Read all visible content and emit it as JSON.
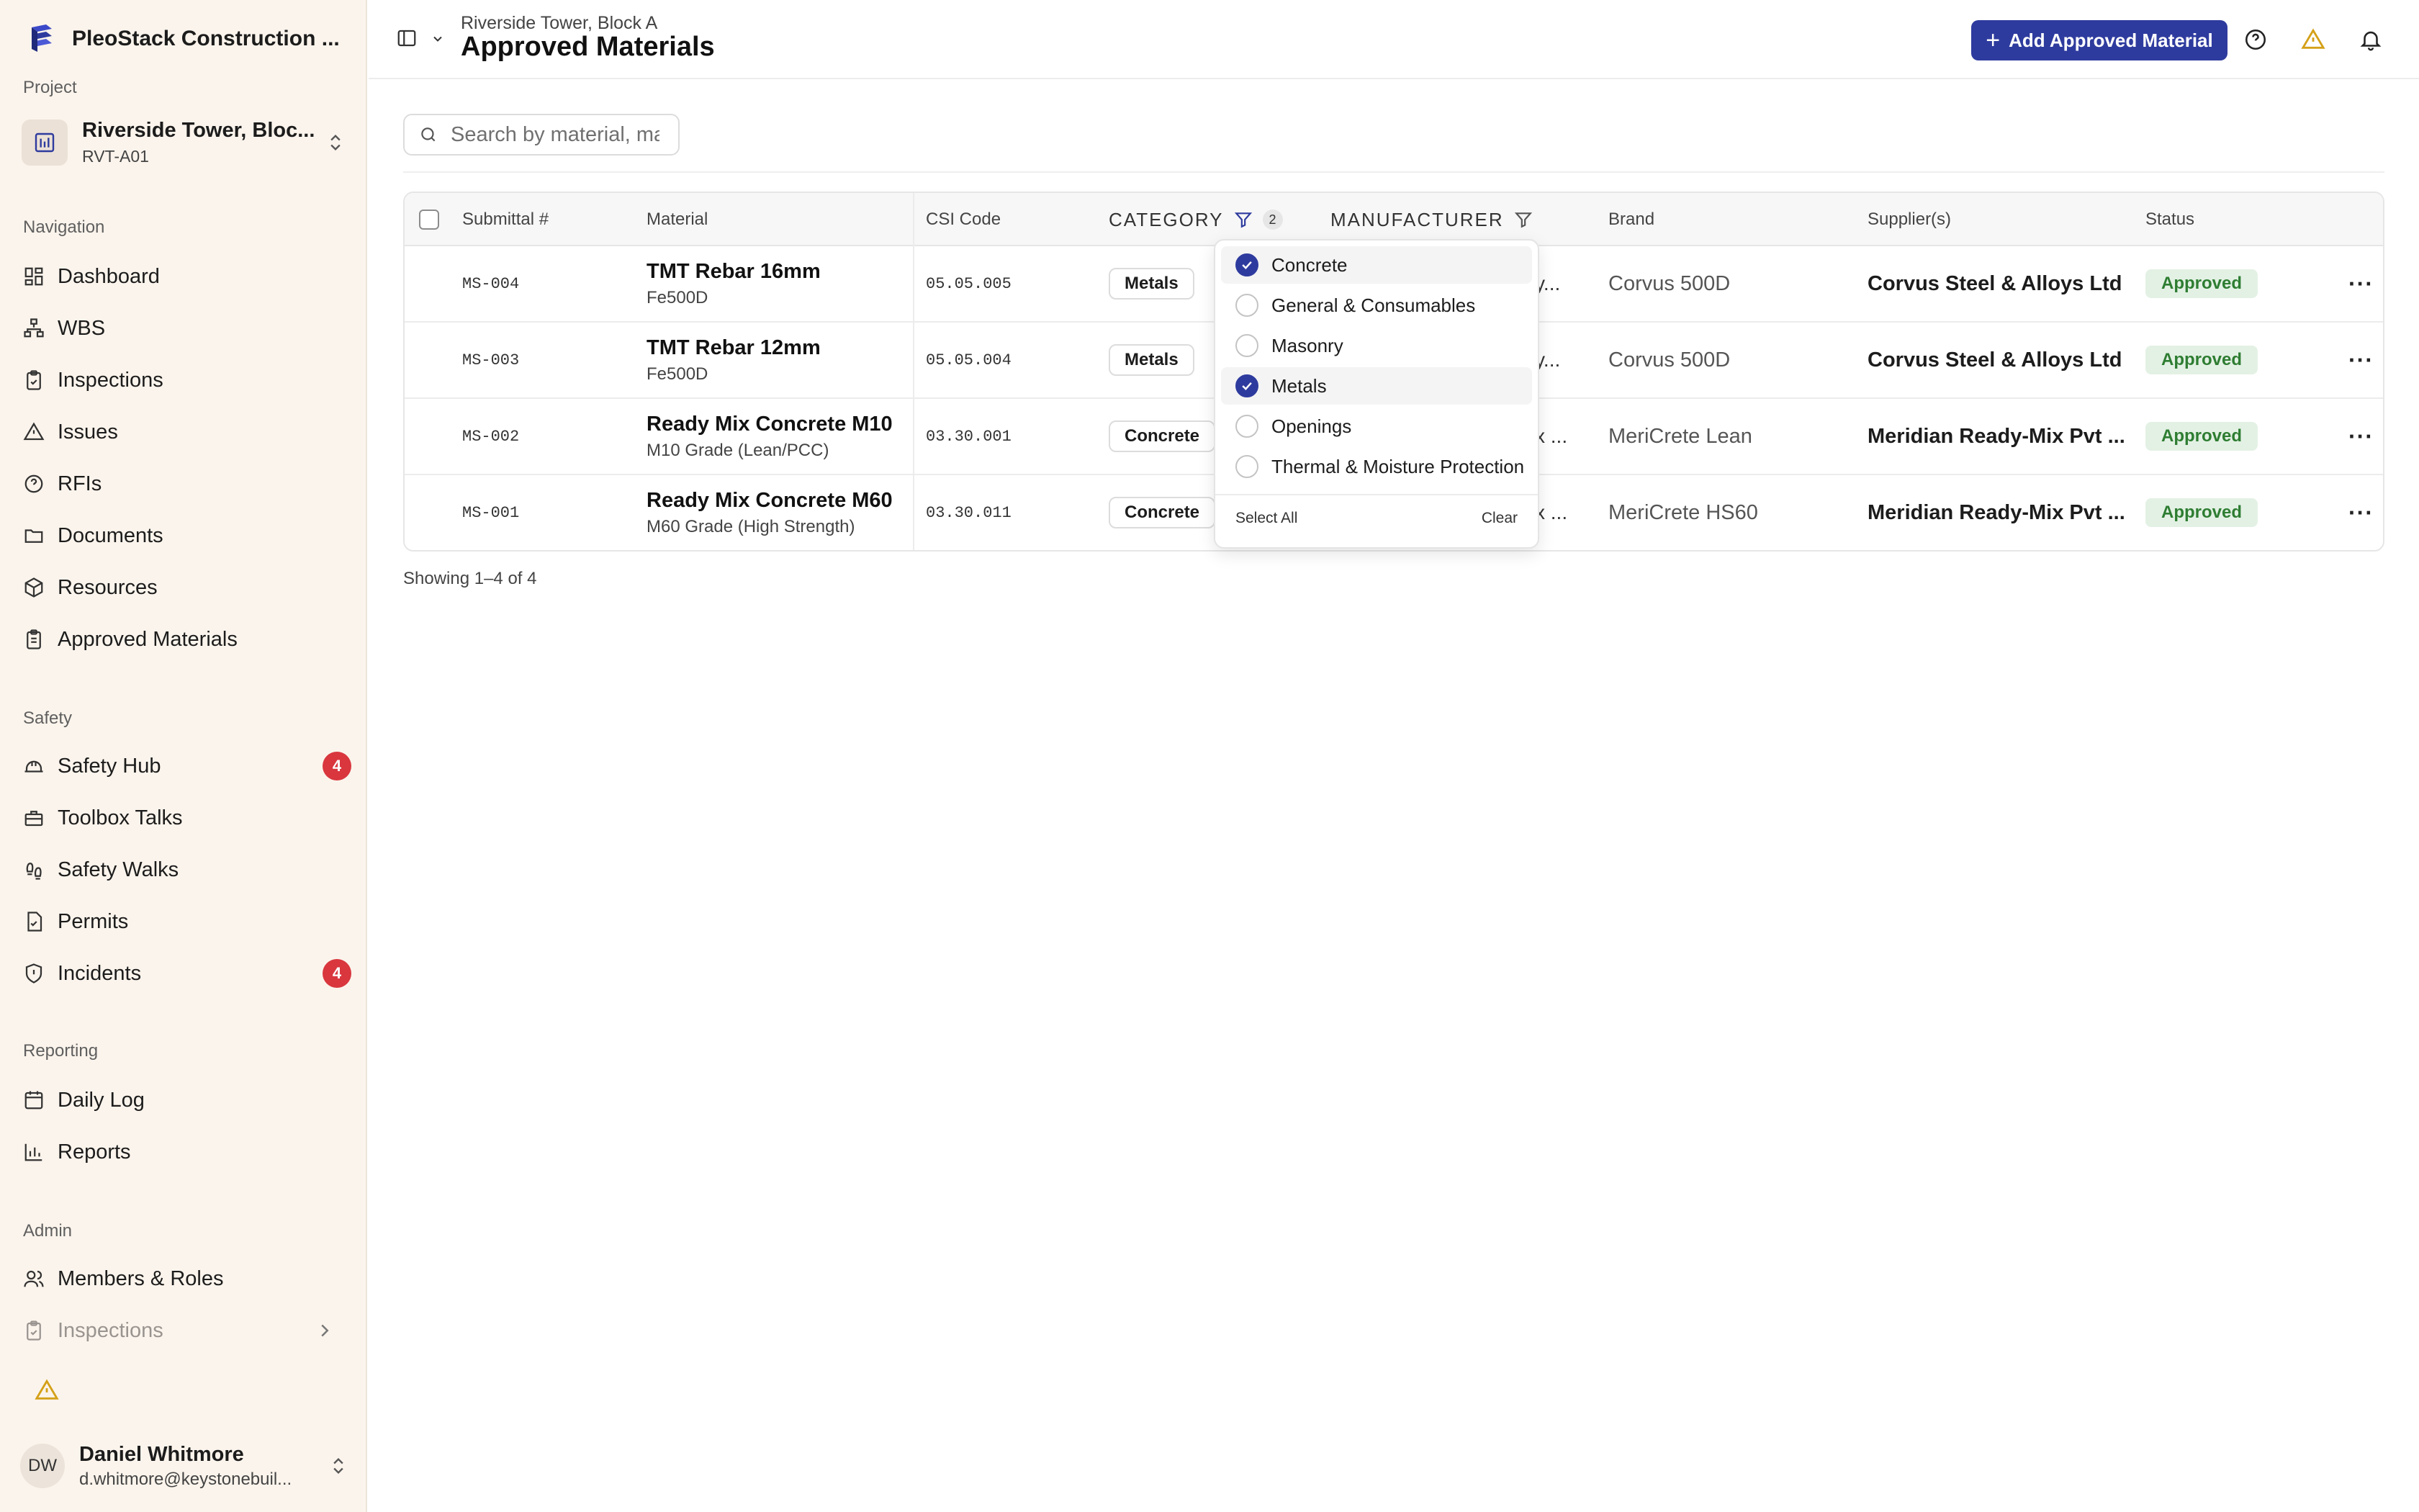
{
  "sidebar": {
    "brand": "PleoStack Construction ...",
    "project_label": "Project",
    "project_name": "Riverside Tower, Bloc...",
    "project_code": "RVT-A01",
    "nav_label": "Navigation",
    "nav": [
      {
        "label": "Dashboard",
        "icon": "dashboard-icon"
      },
      {
        "label": "WBS",
        "icon": "hierarchy-icon"
      },
      {
        "label": "Inspections",
        "icon": "clipboard-check-icon"
      },
      {
        "label": "Issues",
        "icon": "warning-icon"
      },
      {
        "label": "RFIs",
        "icon": "help-circle-icon"
      },
      {
        "label": "Documents",
        "icon": "folder-icon"
      },
      {
        "label": "Resources",
        "icon": "package-icon"
      },
      {
        "label": "Approved Materials",
        "icon": "clipboard-list-icon"
      }
    ],
    "safety_label": "Safety",
    "safety": [
      {
        "label": "Safety Hub",
        "icon": "hard-hat-icon",
        "badge": "4"
      },
      {
        "label": "Toolbox Talks",
        "icon": "toolbox-icon"
      },
      {
        "label": "Safety Walks",
        "icon": "footprints-icon"
      },
      {
        "label": "Permits",
        "icon": "file-check-icon"
      },
      {
        "label": "Incidents",
        "icon": "shield-alert-icon",
        "badge": "4"
      }
    ],
    "reporting_label": "Reporting",
    "reporting": [
      {
        "label": "Daily Log",
        "icon": "calendar-icon"
      },
      {
        "label": "Reports",
        "icon": "bar-chart-icon"
      }
    ],
    "admin_label": "Admin",
    "admin": [
      {
        "label": "Members & Roles",
        "icon": "users-icon"
      },
      {
        "label": "Inspections",
        "icon": "clipboard-check-icon"
      }
    ],
    "user": {
      "initials": "DW",
      "name": "Daniel Whitmore",
      "email": "d.whitmore@keystonebuil..."
    }
  },
  "header": {
    "breadcrumb": "Riverside Tower, Block A",
    "title": "Approved Materials",
    "add_button": "Add Approved Material",
    "accent": "#2e3b9e"
  },
  "search": {
    "placeholder": "Search by material, manufacturer"
  },
  "table": {
    "columns": {
      "submittal": "Submittal #",
      "material": "Material",
      "csi": "CSI Code",
      "category": "CATEGORY",
      "category_filter_count": "2",
      "manufacturer": "MANUFACTURER",
      "brand": "Brand",
      "suppliers": "Supplier(s)",
      "status": "Status"
    },
    "rows": [
      {
        "submittal": "MS-004",
        "material": "TMT Rebar 16mm",
        "sub": "Fe500D",
        "csi": "05.05.005",
        "category": "Metals",
        "manufacturer": "y...",
        "brand": "Corvus 500D",
        "supplier": "Corvus Steel & Alloys Ltd",
        "status": "Approved"
      },
      {
        "submittal": "MS-003",
        "material": "TMT Rebar 12mm",
        "sub": "Fe500D",
        "csi": "05.05.004",
        "category": "Metals",
        "manufacturer": "y...",
        "brand": "Corvus 500D",
        "supplier": "Corvus Steel & Alloys Ltd",
        "status": "Approved"
      },
      {
        "submittal": "MS-002",
        "material": "Ready Mix Concrete M10",
        "sub": "M10 Grade (Lean/PCC)",
        "csi": "03.30.001",
        "category": "Concrete",
        "manufacturer": "x ...",
        "brand": "MeriCrete Lean",
        "supplier": "Meridian Ready-Mix Pvt ...",
        "status": "Approved"
      },
      {
        "submittal": "MS-001",
        "material": "Ready Mix Concrete M60",
        "sub": "M60 Grade (High Strength)",
        "csi": "03.30.011",
        "category": "Concrete",
        "manufacturer": "x ...",
        "brand": "MeriCrete HS60",
        "supplier": "Meridian Ready-Mix Pvt ...",
        "status": "Approved"
      }
    ],
    "row_menu": "···",
    "showing": "Showing 1–4 of 4"
  },
  "category_filter": {
    "options": [
      {
        "label": "Concrete",
        "checked": true
      },
      {
        "label": "General & Consumables",
        "checked": false
      },
      {
        "label": "Masonry",
        "checked": false
      },
      {
        "label": "Metals",
        "checked": true
      },
      {
        "label": "Openings",
        "checked": false
      },
      {
        "label": "Thermal & Moisture Protection",
        "checked": false
      }
    ],
    "select_all": "Select All",
    "clear": "Clear"
  }
}
